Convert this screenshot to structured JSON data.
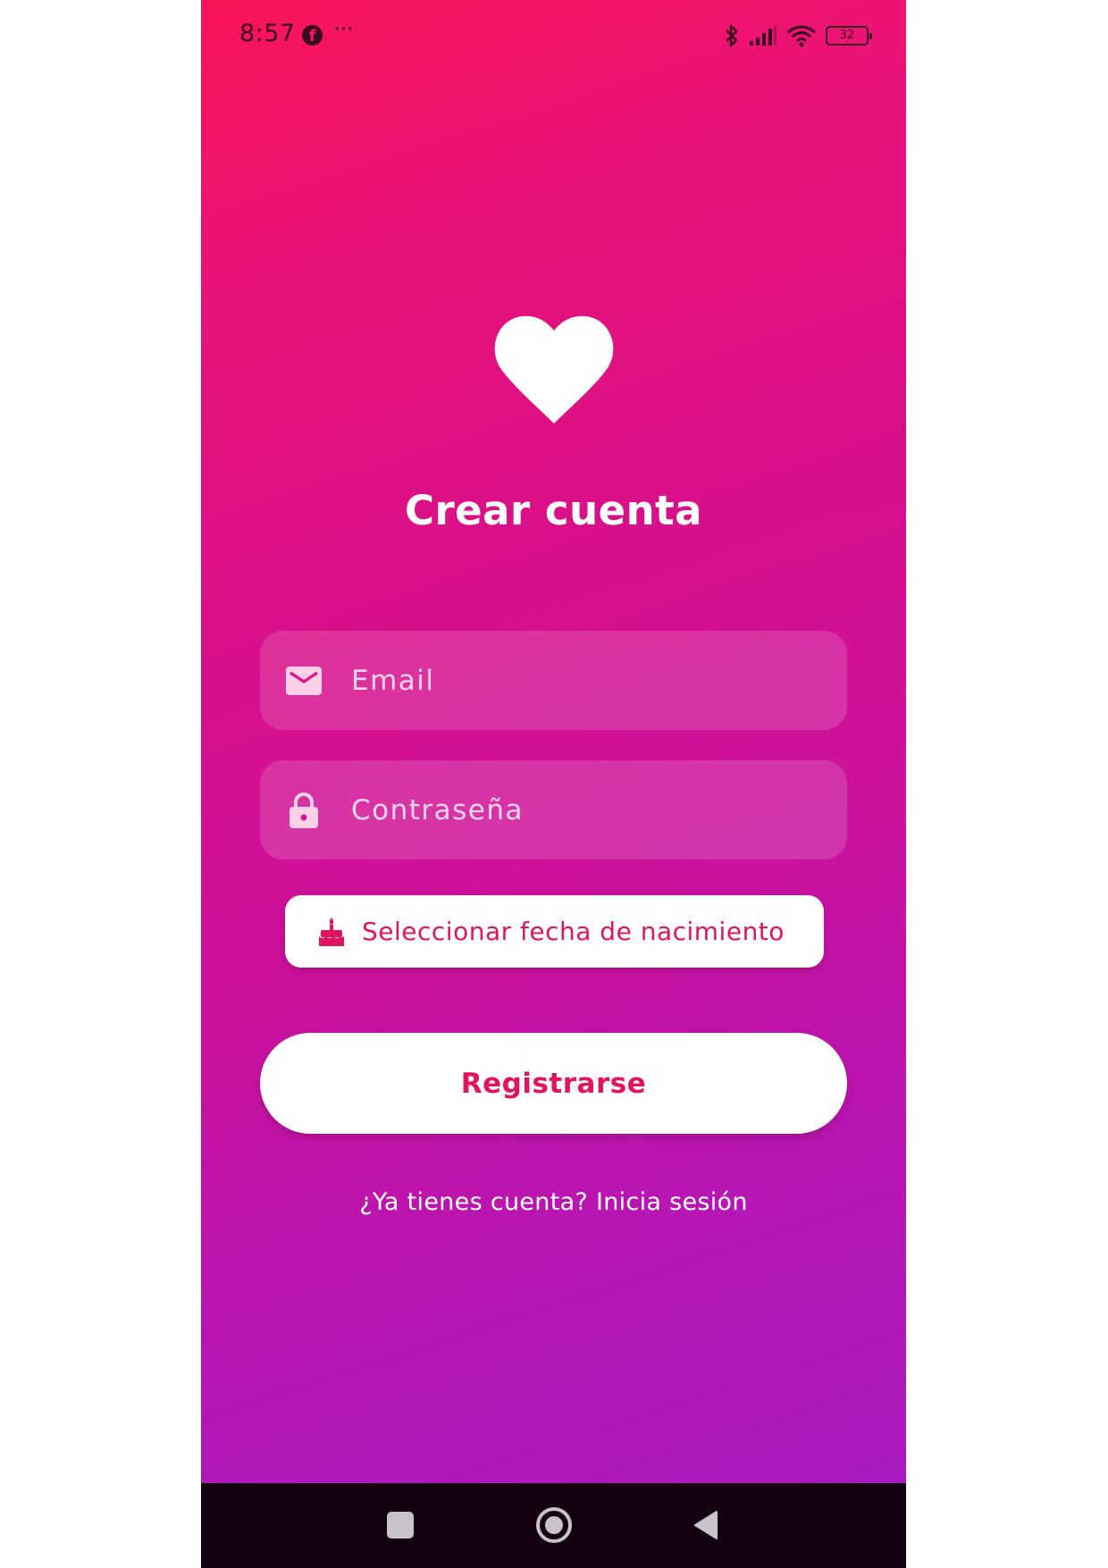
{
  "status_bar": {
    "time": "8:57",
    "battery_level": "32",
    "icons": [
      "facebook-icon",
      "more-dots-icon",
      "bluetooth-icon",
      "signal-icon",
      "wifi-icon",
      "battery-icon"
    ]
  },
  "logo": {
    "icon": "heart-icon",
    "color": "#ffffff"
  },
  "title": "Crear cuenta",
  "form": {
    "email": {
      "placeholder": "Email",
      "value": "",
      "icon": "mail-icon"
    },
    "password": {
      "placeholder": "Contraseña",
      "value": "",
      "icon": "lock-icon"
    },
    "birthdate_button": {
      "label": "Seleccionar fecha de nacimiento",
      "icon": "cake-icon"
    },
    "register_label": "Registrarse",
    "login_link": "¿Ya tienes cuenta? Inicia sesión"
  },
  "nav_bar": {
    "icons": [
      "recents-square-icon",
      "home-circle-icon",
      "back-triangle-icon"
    ]
  },
  "colors": {
    "gradient_top": "#fb1458",
    "gradient_bottom": "#a81bbe",
    "accent": "#e11461",
    "nav_background": "#130010"
  }
}
